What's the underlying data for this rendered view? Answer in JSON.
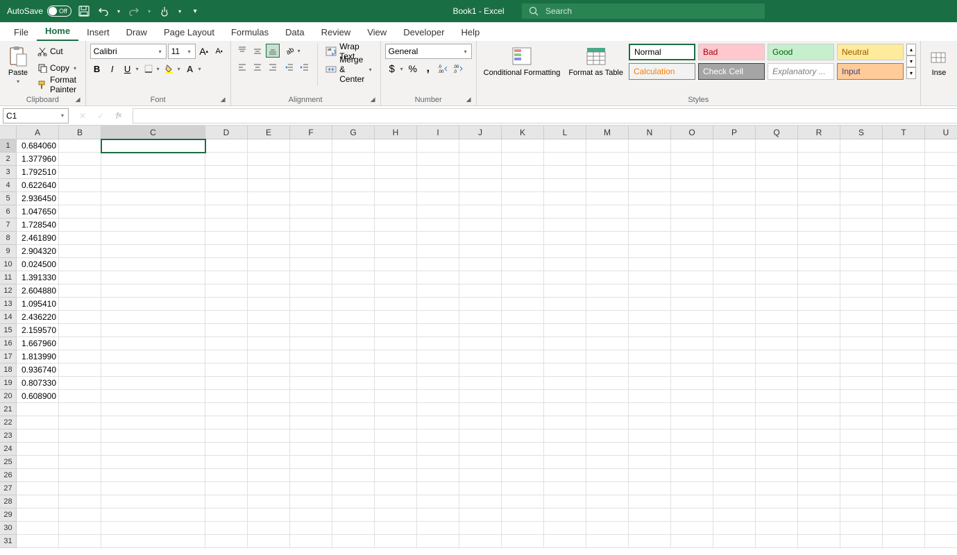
{
  "titleBar": {
    "autoSaveLabel": "AutoSave",
    "autoSaveState": "Off",
    "title": "Book1  -  Excel",
    "searchPlaceholder": "Search"
  },
  "tabs": [
    "File",
    "Home",
    "Insert",
    "Draw",
    "Page Layout",
    "Formulas",
    "Data",
    "Review",
    "View",
    "Developer",
    "Help"
  ],
  "activeTab": "Home",
  "clipboard": {
    "groupLabel": "Clipboard",
    "paste": "Paste",
    "cut": "Cut",
    "copy": "Copy",
    "formatPainter": "Format Painter"
  },
  "font": {
    "groupLabel": "Font",
    "fontName": "Calibri",
    "fontSize": "11"
  },
  "alignment": {
    "groupLabel": "Alignment",
    "wrapText": "Wrap Text",
    "mergeCenter": "Merge & Center"
  },
  "number": {
    "groupLabel": "Number",
    "format": "General"
  },
  "styles": {
    "groupLabel": "Styles",
    "conditional": "Conditional Formatting",
    "formatTable": "Format as Table",
    "items": [
      "Normal",
      "Bad",
      "Good",
      "Neutral",
      "Calculation",
      "Check Cell",
      "Explanatory ...",
      "Input"
    ]
  },
  "insertGroup": {
    "insert": "Inse"
  },
  "nameBox": "C1",
  "formulaBar": "",
  "grid": {
    "selectedCell": "C1",
    "columns": [
      {
        "label": "A",
        "width": 61
      },
      {
        "label": "B",
        "width": 61
      },
      {
        "label": "C",
        "width": 150
      },
      {
        "label": "D",
        "width": 61
      },
      {
        "label": "E",
        "width": 61
      },
      {
        "label": "F",
        "width": 61
      },
      {
        "label": "G",
        "width": 61
      },
      {
        "label": "H",
        "width": 61
      },
      {
        "label": "I",
        "width": 61
      },
      {
        "label": "J",
        "width": 61
      },
      {
        "label": "K",
        "width": 61
      },
      {
        "label": "L",
        "width": 61
      },
      {
        "label": "M",
        "width": 61
      },
      {
        "label": "N",
        "width": 61
      },
      {
        "label": "O",
        "width": 61
      },
      {
        "label": "P",
        "width": 61
      },
      {
        "label": "Q",
        "width": 61
      },
      {
        "label": "R",
        "width": 61
      },
      {
        "label": "S",
        "width": 61
      },
      {
        "label": "T",
        "width": 61
      },
      {
        "label": "U",
        "width": 61
      }
    ],
    "rowCount": 31,
    "dataColumnA": [
      "0.684060",
      "1.377960",
      "1.792510",
      "0.622640",
      "2.936450",
      "1.047650",
      "1.728540",
      "2.461890",
      "2.904320",
      "0.024500",
      "1.391330",
      "2.604880",
      "1.095410",
      "2.436220",
      "2.159570",
      "1.667960",
      "1.813990",
      "0.936740",
      "0.807330",
      "0.608900"
    ]
  }
}
